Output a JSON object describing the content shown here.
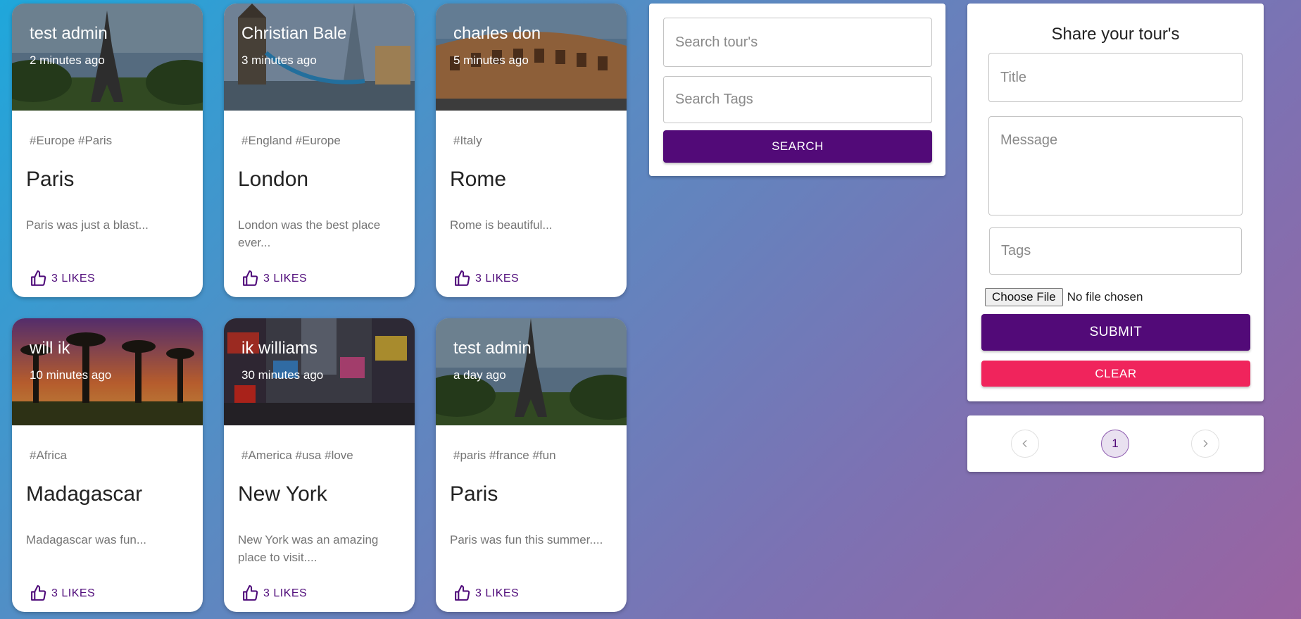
{
  "posts": [
    {
      "author": "test admin",
      "time": "2 minutes ago",
      "tags": "#Europe #Paris",
      "title": "Paris",
      "message": "Paris was just a blast...",
      "likes": "3 LIKES",
      "image_icon": "eiffel-tower-image"
    },
    {
      "author": "Christian Bale",
      "time": "3 minutes ago",
      "tags": "#England #Europe",
      "title": "London",
      "message": "London was the best place ever...",
      "likes": "3 LIKES",
      "image_icon": "london-city-image"
    },
    {
      "author": "charles don",
      "time": "5 minutes ago",
      "tags": "#Italy",
      "title": "Rome",
      "message": "Rome is beautiful...",
      "likes": "3 LIKES",
      "image_icon": "colosseum-image"
    },
    {
      "author": "will ik",
      "time": "10 minutes ago",
      "tags": "#Africa",
      "title": "Madagascar",
      "message": "Madagascar was fun...",
      "likes": "3 LIKES",
      "image_icon": "baobab-sunset-image"
    },
    {
      "author": "ik williams",
      "time": "30 minutes ago",
      "tags": "#America #usa #love",
      "title": "New York",
      "message": "New York was an amazing place to visit....",
      "likes": "3 LIKES",
      "image_icon": "times-square-image"
    },
    {
      "author": "test admin",
      "time": "a day ago",
      "tags": "#paris #france #fun",
      "title": "Paris",
      "message": "Paris was fun this summer....",
      "likes": "3 LIKES",
      "image_icon": "eiffel-tower-image"
    }
  ],
  "search": {
    "tours_placeholder": "Search tour's",
    "tags_placeholder": "Search Tags",
    "button_label": "SEARCH"
  },
  "form": {
    "title": "Share your tour's",
    "title_placeholder": "Title",
    "message_placeholder": "Message",
    "tags_placeholder": "Tags",
    "file_button": "Choose File",
    "file_status": "No file chosen",
    "submit_label": "SUBMIT",
    "clear_label": "CLEAR"
  },
  "pagination": {
    "current_page": "1"
  },
  "colors": {
    "primary": "#520a78",
    "danger": "#f0245c",
    "background_start": "#1fa7db",
    "background_end": "#9a63a1"
  }
}
